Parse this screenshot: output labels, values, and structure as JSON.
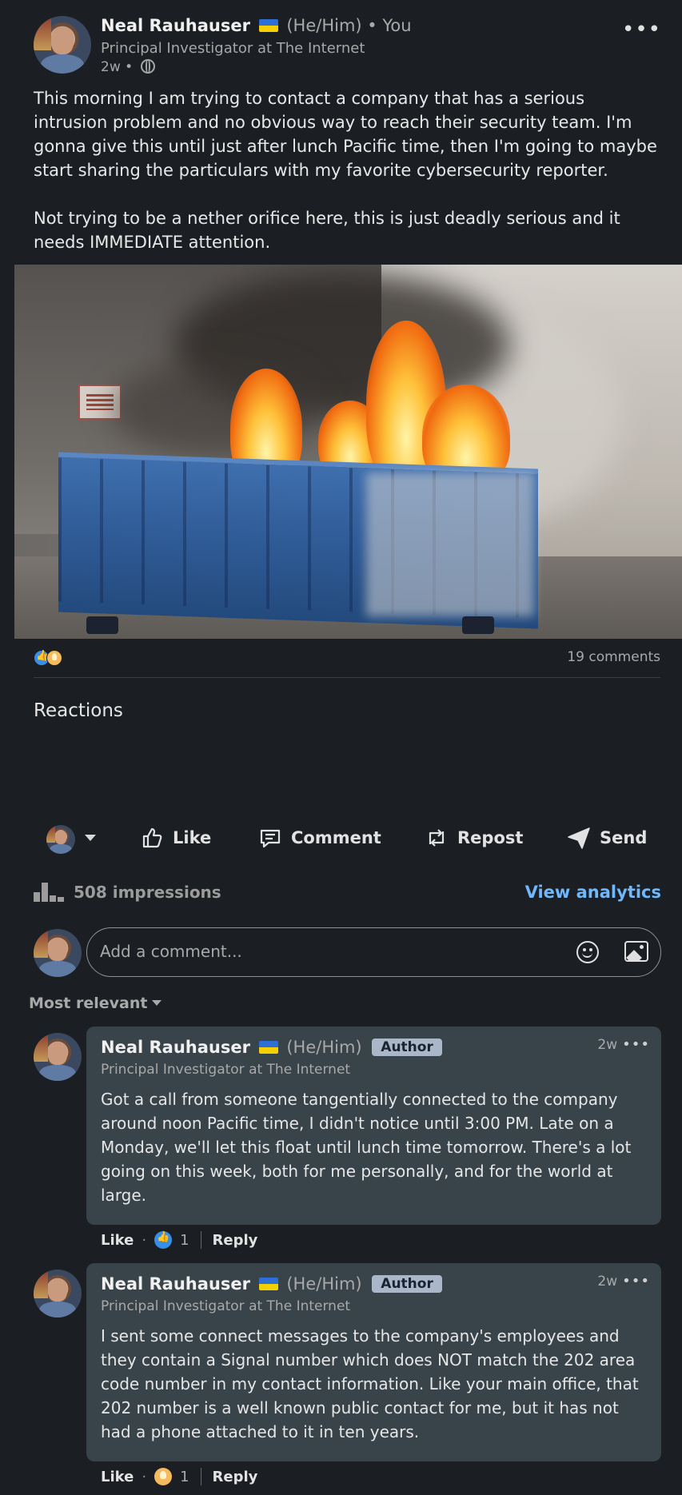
{
  "post": {
    "author_name": "Neal Rauhauser",
    "author_meta": "(He/Him) • You",
    "author_title": "Principal Investigator at The Internet",
    "time": "2w •",
    "text": "This morning I am trying to contact a company that has a serious intrusion problem and no obvious way to reach their security team. I'm gonna give this until just after lunch Pacific time, then I'm going to maybe start sharing the particulars with my favorite cybersecurity reporter.\n\nNot trying to be a nether orifice here, this is just deadly serious and it needs IMMEDIATE attention.",
    "more_icon": "more-horizontal-icon"
  },
  "social": {
    "comments_count": "19 comments",
    "reaction_icons": [
      "like-reaction-icon",
      "insightful-reaction-icon"
    ],
    "reactions_heading": "Reactions"
  },
  "actions": {
    "like": "Like",
    "comment": "Comment",
    "repost": "Repost",
    "send": "Send"
  },
  "analytics": {
    "impressions": "508 impressions",
    "view_analytics": "View analytics"
  },
  "add_comment": {
    "placeholder": "Add a comment..."
  },
  "sort": {
    "label": "Most relevant"
  },
  "comments": [
    {
      "name": "Neal Rauhauser",
      "pronouns": "(He/Him)",
      "badge": "Author",
      "title": "Principal Investigator at The Internet",
      "time": "2w",
      "text": "Got a call from someone tangentially connected to the company around noon Pacific time, I didn't notice until 3:00 PM. Late on a Monday, we'll let this float until lunch time tomorrow. There's a lot going on this week, both for me personally, and for the world at large.",
      "like_label": "Like",
      "reaction_count": "1",
      "reply_label": "Reply"
    },
    {
      "name": "Neal Rauhauser",
      "pronouns": "(He/Him)",
      "badge": "Author",
      "title": "Principal Investigator at The Internet",
      "time": "2w",
      "text": "I sent some connect messages to the company's employees and they contain a Signal number which does NOT match the 202 area code number in my contact information. Like your main office, that 202 number is a well known public contact for me, but it has not had a phone attached to it in ten years.",
      "like_label": "Like",
      "reaction_count": "1",
      "reply_label": "Reply"
    }
  ],
  "colors": {
    "background": "#1b1f23",
    "comment_bubble": "#38434a",
    "link_blue": "#71b7fb",
    "like_blue": "#378fe9",
    "insight_yellow": "#f5bb5c"
  }
}
